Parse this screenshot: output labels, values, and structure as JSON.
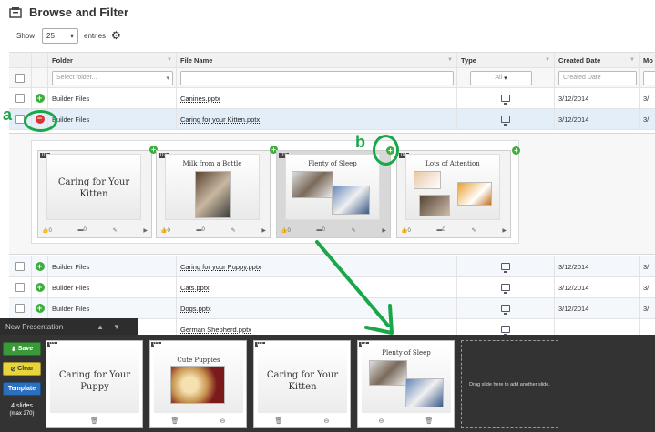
{
  "header": {
    "title": "Browse and Filter"
  },
  "show": {
    "label": "Show",
    "value": "25",
    "suffix": "entries"
  },
  "columns": {
    "folder": "Folder",
    "file": "File Name",
    "type": "Type",
    "created": "Created Date",
    "modified": "Mo"
  },
  "filters": {
    "folder_placeholder": "Select folder...",
    "type_value": "All",
    "date_placeholder": "Created Date"
  },
  "rows": [
    {
      "folder": "Builder Files",
      "file": "Canines.pptx",
      "date": "3/12/2014",
      "mod": "3/"
    },
    {
      "folder": "Builder Files",
      "file": "Caring for your Kitten.pptx",
      "date": "3/12/2014",
      "mod": "3/"
    },
    {
      "folder": "Builder Files",
      "file": "Caring for your Puppy.pptx",
      "date": "3/12/2014",
      "mod": "3/"
    },
    {
      "folder": "Builder Files",
      "file": "Cats.pptx",
      "date": "3/12/2014",
      "mod": "3/"
    },
    {
      "folder": "Builder Files",
      "file": "Dogs.pptx",
      "date": "3/12/2014",
      "mod": "3/"
    },
    {
      "folder": "",
      "file": "German Shepherd.pptx",
      "date": "",
      "mod": ""
    }
  ],
  "thumbs": [
    {
      "num": "01",
      "title": "Caring for Your Kitten",
      "likes": "0",
      "comments": "0"
    },
    {
      "num": "02",
      "title": "Milk from a Bottle",
      "likes": "0",
      "comments": "0"
    },
    {
      "num": "03",
      "title": "Plenty of Sleep",
      "likes": "0",
      "comments": "0"
    },
    {
      "num": "04",
      "title": "Lots of Attention",
      "likes": "0",
      "comments": "0"
    }
  ],
  "annotations": {
    "a": "a",
    "b": "b"
  },
  "presentation": {
    "title": "New Presentation",
    "save": "Save",
    "clear": "Clear",
    "template": "Template",
    "count": "4 slides",
    "max": "(max 270)",
    "slides": [
      {
        "num": "01",
        "title": "Caring for Your Puppy"
      },
      {
        "num": "02",
        "title": "Cute Puppies"
      },
      {
        "num": "03",
        "title": "Caring for Your Kitten"
      },
      {
        "num": "04",
        "title": "Plenty of Sleep"
      }
    ],
    "dropzone": "Drag slide here to add another slide."
  },
  "colors": {
    "accent_green": "#1aa74a",
    "save_green": "#3a9a3a",
    "clear_yellow": "#e8d53b",
    "template_blue": "#2b6fc0"
  }
}
